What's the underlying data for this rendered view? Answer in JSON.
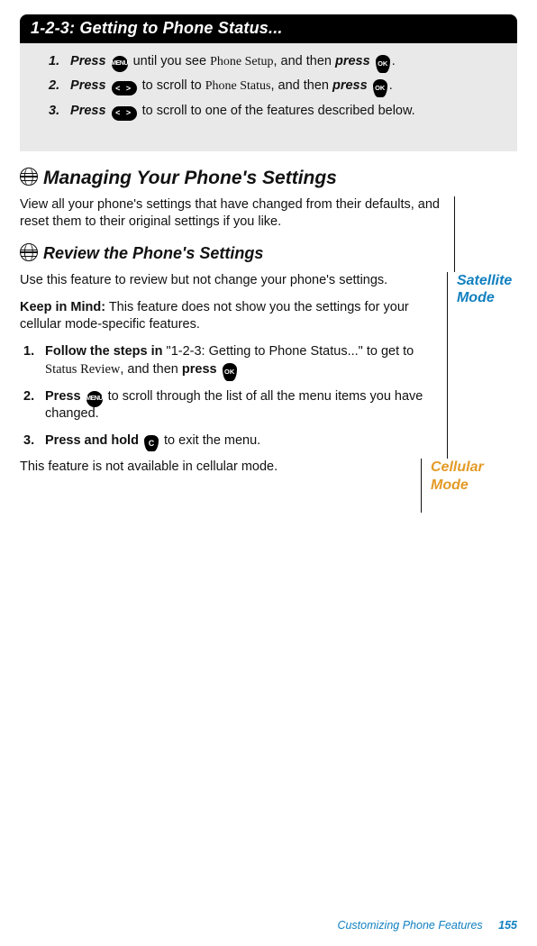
{
  "header": {
    "title": "1-2-3: Getting to Phone Status..."
  },
  "gray_steps": [
    {
      "num": "1.",
      "pre": "Press ",
      "mid_after_menu": " until you see ",
      "lcd": "Phone Setup",
      "post": ", and then ",
      "press": "press ",
      "end": "."
    },
    {
      "num": "2.",
      "pre": "Press ",
      "mid_after_lr": " to scroll to ",
      "lcd": "Phone Status",
      "post": ", and then ",
      "press": "press ",
      "end": "."
    },
    {
      "num": "3.",
      "pre": "Press ",
      "mid_after_lr_b": " to scroll to one of the features described below."
    }
  ],
  "icons": {
    "menu": "MENU",
    "ok": "OK",
    "lr": "<  >",
    "c": "C"
  },
  "section1": {
    "title": "Managing Your Phone's Settings",
    "intro": "View all your phone's settings that have changed from their defaults, and reset them to their original settings if you like."
  },
  "section2": {
    "title": "Review the Phone's Settings",
    "satellite_label_l1": "Satellite",
    "satellite_label_l2": "Mode",
    "p1": "Use this feature to review but not change your phone's settings.",
    "keep_label": "Keep in Mind:",
    "keep_text": " This feature does not show you the settings for your cellular mode-specific features.",
    "steps": [
      {
        "num": "1.",
        "bold": "Follow the steps in ",
        "plain1": "\"1-2-3: Getting to Phone Status...\" to get to ",
        "lcd": "Status Review",
        "plain2": ", and then ",
        "press": "press "
      },
      {
        "num": "2.",
        "bold": "Press ",
        "plain": " to scroll through the list of all the menu items you have changed."
      },
      {
        "num": "3.",
        "bold": "Press and hold ",
        "plain": " to exit the menu."
      }
    ],
    "cell_text": "This feature is not available in cellular mode.",
    "cell_label_l1": "Cellular",
    "cell_label_l2": "Mode"
  },
  "footer": {
    "chapter": "Customizing Phone Features",
    "page": "155"
  }
}
